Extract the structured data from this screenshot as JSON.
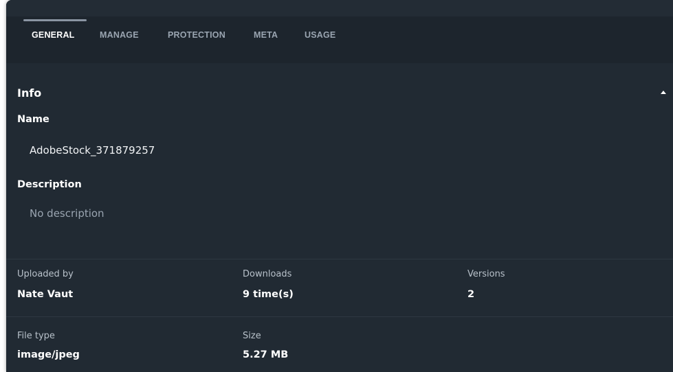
{
  "tabs": [
    {
      "label": "GENERAL",
      "active": true
    },
    {
      "label": "MANAGE",
      "active": false
    },
    {
      "label": "PROTECTION",
      "active": false
    },
    {
      "label": "META",
      "active": false
    },
    {
      "label": "USAGE",
      "active": false
    }
  ],
  "info": {
    "title": "Info",
    "collapse_icon": "caret-up-icon",
    "name_label": "Name",
    "name_value": "AdobeStock_371879257",
    "description_label": "Description",
    "description_value": "No description"
  },
  "stats_row1": {
    "uploaded_by_label": "Uploaded by",
    "uploaded_by_value": "Nate Vaut",
    "downloads_label": "Downloads",
    "downloads_value": "9 time(s)",
    "versions_label": "Versions",
    "versions_value": "2"
  },
  "stats_row2": {
    "file_type_label": "File type",
    "file_type_value": "image/jpeg",
    "size_label": "Size",
    "size_value": "5.27 MB"
  },
  "colors": {
    "panel_bg": "#212a33",
    "tab_inactive": "#9aa5b1",
    "text_primary": "#ffffff",
    "text_muted": "#9aa5b1"
  }
}
